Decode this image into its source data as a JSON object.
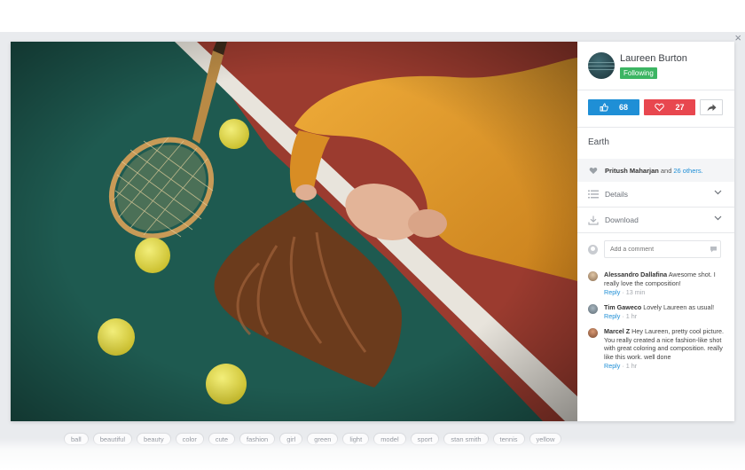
{
  "window": {
    "close_glyph": "×"
  },
  "author": {
    "name": "Laureen Burton",
    "follow_label": "Following"
  },
  "actions": {
    "likes": "68",
    "loves": "27",
    "like_icon": "thumbs-up-icon",
    "love_icon": "heart-icon",
    "share_icon": "share-arrow-icon"
  },
  "location": "Earth",
  "likers": {
    "names": "Pritush Maharjan",
    "connector": "and",
    "others": "26 others."
  },
  "sections": [
    {
      "label": "Details",
      "icon": "list-icon"
    },
    {
      "label": "Download",
      "icon": "download-icon"
    }
  ],
  "comment_input": {
    "placeholder": "Add a comment"
  },
  "comments": [
    {
      "author": "Alessandro Dallafina",
      "text": "Awesome shot. I really love the composition!",
      "reply": "Reply",
      "time": "13 min"
    },
    {
      "author": "Tim Gaweco",
      "text": "Lovely Laureen as usual!",
      "reply": "Reply",
      "time": "1 hr"
    },
    {
      "author": "Marcel Z",
      "text": "Hey Laureen, pretty cool picture. You really created a nice fashion-like shot with great coloring and composition. really like this work. well done",
      "reply": "Reply",
      "time": "1 hr"
    }
  ],
  "tags": [
    "ball",
    "beautiful",
    "beauty",
    "color",
    "cute",
    "fashion",
    "girl",
    "green",
    "light",
    "model",
    "sport",
    "stan smith",
    "tennis",
    "yellow"
  ],
  "colors": {
    "like": "#1f8fd6",
    "love": "#e8474f",
    "following": "#3cb563",
    "court_green": "#1d4f48",
    "court_red": "#9c3a2e",
    "sweater": "#e09a2a"
  }
}
